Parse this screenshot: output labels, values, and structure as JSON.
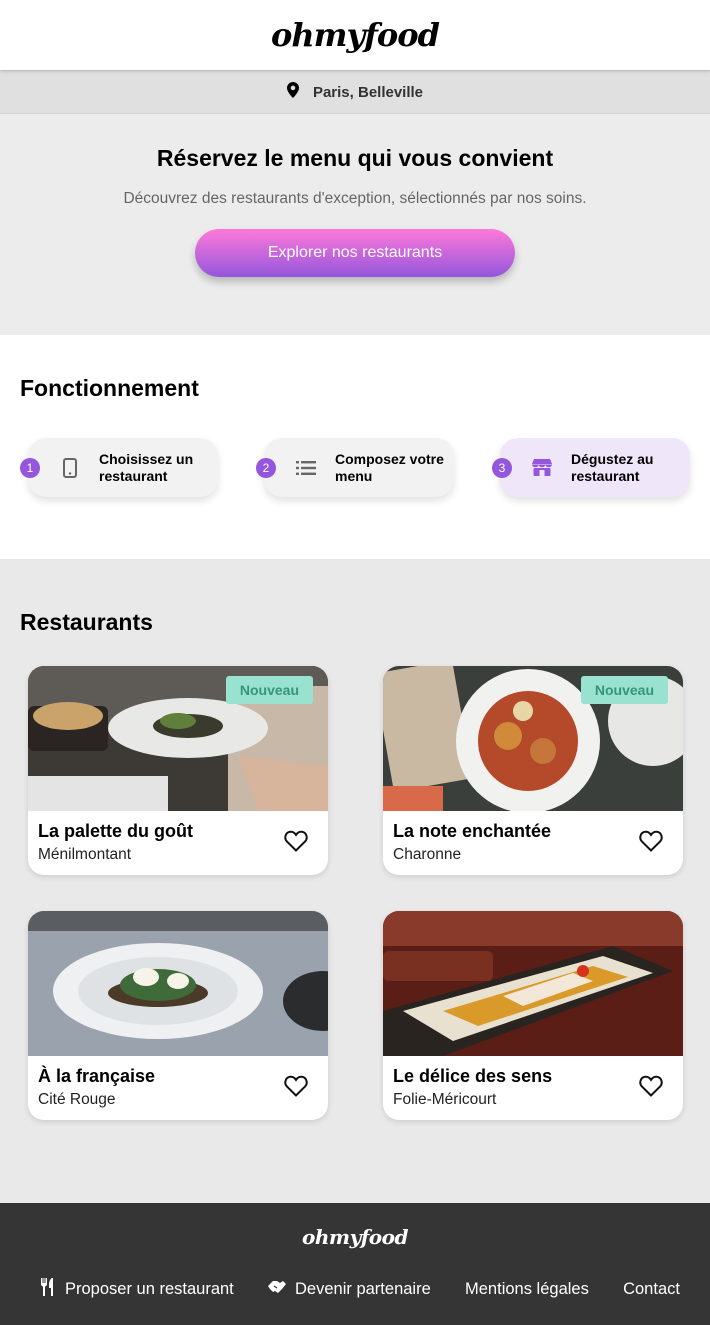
{
  "header": {
    "logo": "ohmyfood"
  },
  "location": {
    "icon": "map-pin-icon",
    "text": "Paris, Belleville"
  },
  "hero": {
    "title": "Réservez le menu qui vous convient",
    "subtitle": "Découvrez des restaurants d'exception, sélectionnés par nos soins.",
    "cta_label": "Explorer nos restaurants"
  },
  "how": {
    "title": "Fonctionnement",
    "steps": [
      {
        "num": "1",
        "label": "Choisissez un restaurant",
        "icon": "mobile-phone-icon"
      },
      {
        "num": "2",
        "label": "Composez votre menu",
        "icon": "list-icon"
      },
      {
        "num": "3",
        "label": "Dégustez au restaurant",
        "icon": "storefront-icon"
      }
    ]
  },
  "restaurants": {
    "title": "Restaurants",
    "items": [
      {
        "name": "La palette du goût",
        "area": "Ménilmontant",
        "badge": "Nouveau"
      },
      {
        "name": "La note enchantée",
        "area": "Charonne",
        "badge": "Nouveau"
      },
      {
        "name": "À la française",
        "area": "Cité Rouge"
      },
      {
        "name": "Le délice des sens",
        "area": "Folie-Méricourt"
      }
    ]
  },
  "footer": {
    "logo": "ohmyfood",
    "links": [
      {
        "label": "Proposer un restaurant",
        "icon": "utensils-icon"
      },
      {
        "label": "Devenir partenaire",
        "icon": "handshake-icon"
      },
      {
        "label": "Mentions légales"
      },
      {
        "label": "Contact"
      }
    ]
  },
  "colors": {
    "accent": "#9356dc",
    "gradient_start": "#ff79da",
    "badge_bg": "#99e2d0",
    "badge_text": "#379577",
    "footer_bg": "#353535"
  }
}
